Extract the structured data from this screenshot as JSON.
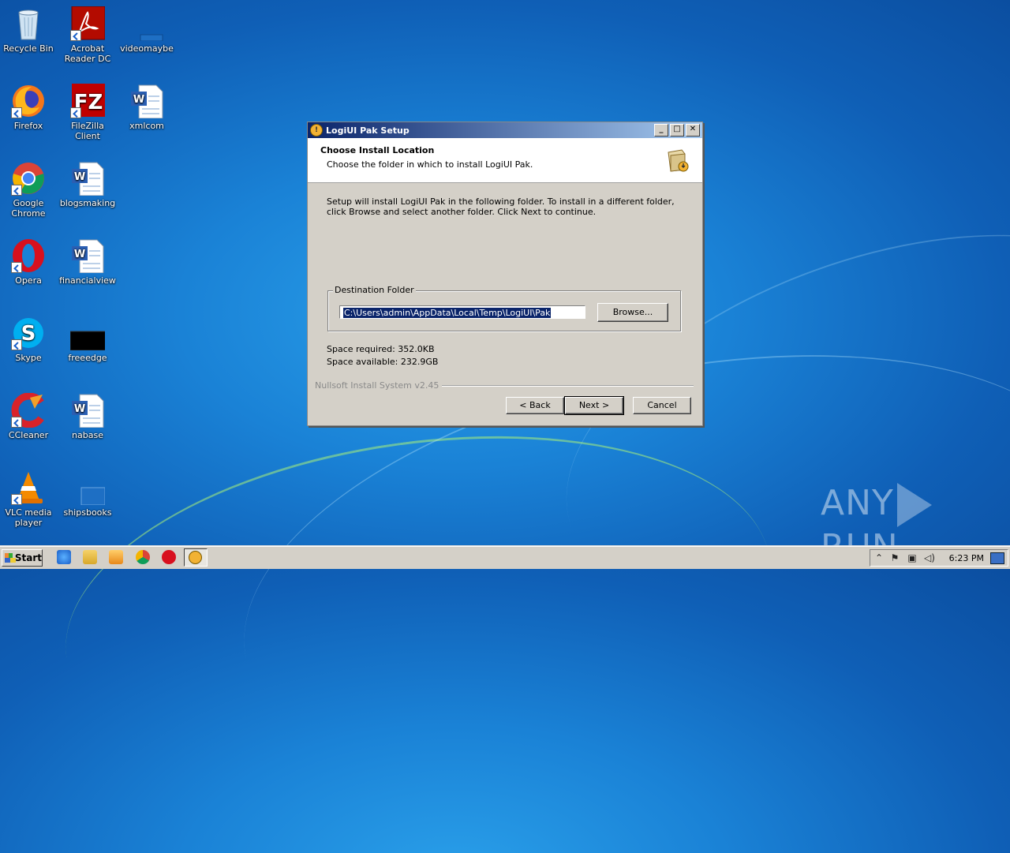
{
  "desktop": {
    "icons": [
      {
        "label": "Recycle Bin",
        "icon": "recycle-bin-icon"
      },
      {
        "label": "Acrobat Reader DC",
        "icon": "acrobat-icon"
      },
      {
        "label": "videomaybe",
        "icon": "blank-file-icon"
      },
      {
        "label": "Firefox",
        "icon": "firefox-icon"
      },
      {
        "label": "FileZilla Client",
        "icon": "filezilla-icon"
      },
      {
        "label": "xmlcom",
        "icon": "word-doc-icon"
      },
      {
        "label": "Google Chrome",
        "icon": "chrome-icon"
      },
      {
        "label": "blogsmaking",
        "icon": "word-doc-icon"
      },
      {
        "label": "Opera",
        "icon": "opera-icon"
      },
      {
        "label": "financialview",
        "icon": "word-doc-icon"
      },
      {
        "label": "Skype",
        "icon": "skype-icon"
      },
      {
        "label": "freeedge",
        "icon": "black-thumbnail-icon"
      },
      {
        "label": "CCleaner",
        "icon": "ccleaner-icon"
      },
      {
        "label": "nabase",
        "icon": "word-doc-icon"
      },
      {
        "label": "VLC media player",
        "icon": "vlc-icon"
      },
      {
        "label": "shipsbooks",
        "icon": "blank-file-icon"
      }
    ]
  },
  "dialog": {
    "title": "LogiUI Pak Setup",
    "header_title": "Choose Install Location",
    "header_subtitle": "Choose the folder in which to install LogiUI Pak.",
    "body_text": "Setup will install LogiUI Pak in the following folder. To install in a different folder, click Browse and select another folder. Click Next to continue.",
    "destination_label": "Destination Folder",
    "destination_path": "C:\\Users\\admin\\AppData\\Local\\Temp\\LogiUI\\Pak",
    "browse_label": "Browse...",
    "space_required": "Space required: 352.0KB",
    "space_available": "Space available: 232.9GB",
    "branding": "Nullsoft Install System v2.45",
    "back_label": "< Back",
    "next_label": "Next >",
    "cancel_label": "Cancel"
  },
  "taskbar": {
    "start_label": "Start",
    "clock": "6:23 PM"
  },
  "watermark": {
    "left": "ANY",
    "right": "RUN"
  }
}
